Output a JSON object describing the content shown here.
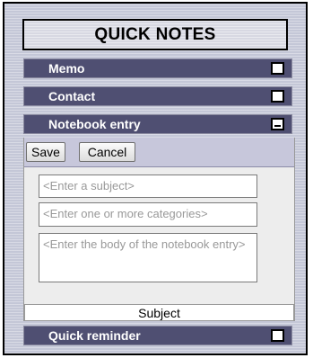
{
  "title": "QUICK NOTES",
  "items": [
    {
      "label": "Memo",
      "icon": "maximize-icon"
    },
    {
      "label": "Contact",
      "icon": "maximize-icon"
    },
    {
      "label": "Notebook entry",
      "icon": "minimize-icon"
    },
    {
      "label": "Quick reminder",
      "icon": "maximize-icon"
    }
  ],
  "editor": {
    "save_label": "Save",
    "cancel_label": "Cancel",
    "subject_placeholder": "<Enter a subject>",
    "categories_placeholder": "<Enter one or more categories>",
    "body_placeholder": "<Enter the body of the notebook entry>",
    "status": "Subject"
  },
  "colors": {
    "bar": "#4f4f72",
    "panel": "#c4c7d7",
    "toolbar": "#c7c7db"
  }
}
